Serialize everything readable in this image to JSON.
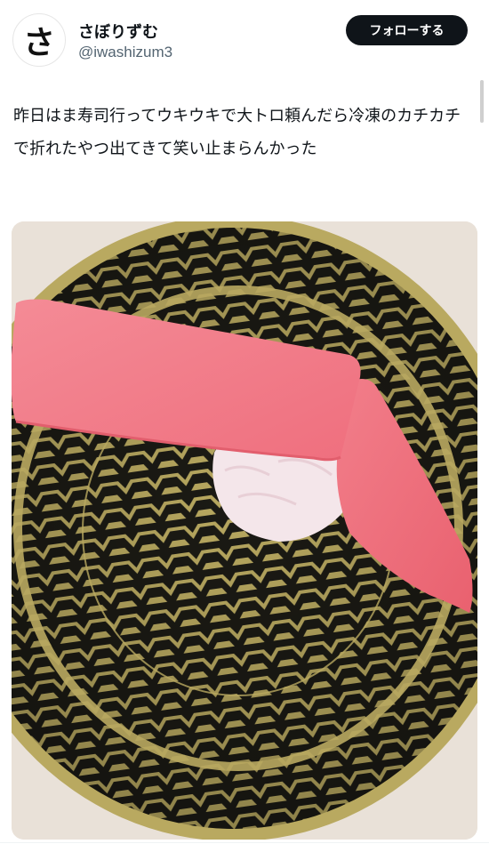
{
  "user": {
    "avatar_glyph": "さ",
    "display_name": "さぼりずむ",
    "handle": "@iwashizum3"
  },
  "follow_button": {
    "label": "フォローする"
  },
  "tweet": {
    "text": "昨日はま寿司行ってウキウキで大トロ頼んだら冷凍のカチカチで折れたやつ出てきて笑い止まらんかった"
  },
  "media": {
    "icon": "photo-sushi-plate",
    "colors": {
      "plate_gold": "#b9a960",
      "plate_dark": "#1b1a14",
      "tuna": "#f07a86",
      "rice": "#f4e6ea",
      "table": "#e9e1d8"
    }
  }
}
